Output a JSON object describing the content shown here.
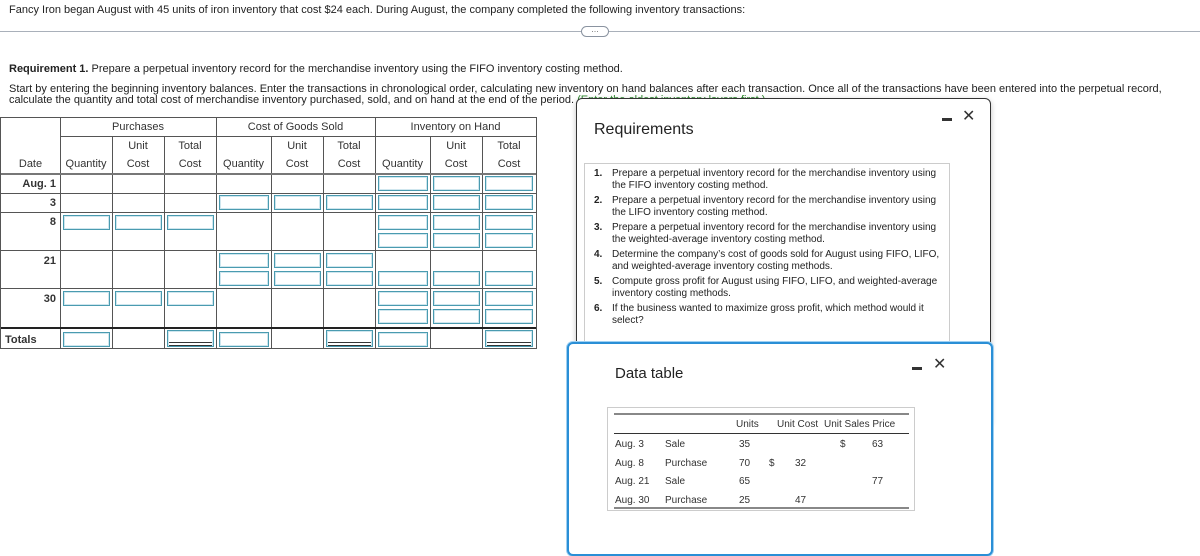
{
  "intro_text": "Fancy Iron began August with 45 units of iron inventory that cost $24 each. During August, the company completed the following inventory transactions:",
  "more_button_label": "…",
  "requirement_heading": {
    "bold": "Requirement 1.",
    "text": " Prepare a perpetual inventory record for the merchandise inventory using the FIFO inventory costing method."
  },
  "instructions": {
    "text": "Start by entering the beginning inventory balances. Enter the transactions in chronological order, calculating new inventory on hand balances after each transaction. Once all of the transactions have been entered into the perpetual record, calculate the quantity and total cost of merchandise inventory purchased, sold, and on hand at the end of the period. ",
    "hint": "(Enter the oldest inventory layers first.)"
  },
  "inventory_table": {
    "groups": [
      "Purchases",
      "Cost of Goods Sold",
      "Inventory on Hand"
    ],
    "date_header": "Date",
    "sub_headers": {
      "quantity": "Quantity",
      "unit_top": "Unit",
      "unit_bottom": "Cost",
      "total_top": "Total",
      "total_bottom": "Cost"
    },
    "rows": [
      {
        "date": "Aug. 1"
      },
      {
        "date": "3"
      },
      {
        "date": "8"
      },
      {
        "date": "21"
      },
      {
        "date": "30"
      }
    ],
    "totals_label": "Totals"
  },
  "requirements_panel": {
    "title": "Requirements",
    "items": [
      {
        "num": "1.",
        "text": "Prepare a perpetual inventory record for the merchandise inventory using the FIFO inventory costing method."
      },
      {
        "num": "2.",
        "text": "Prepare a perpetual inventory record for the merchandise inventory using the LIFO inventory costing method."
      },
      {
        "num": "3.",
        "text": "Prepare a perpetual inventory record for the merchandise inventory using the weighted-average inventory costing method."
      },
      {
        "num": "4.",
        "text": "Determine the company’s cost of goods sold for August using FIFO, LIFO, and weighted-average inventory costing methods."
      },
      {
        "num": "5.",
        "text": "Compute gross profit for August using FIFO, LIFO, and weighted-average inventory costing methods."
      },
      {
        "num": "6.",
        "text": "If the business wanted to maximize gross profit, which method would it select?"
      }
    ]
  },
  "data_panel": {
    "title": "Data table",
    "headers": {
      "units": "Units",
      "unit_cost": "Unit Cost",
      "unit_sales_price": "Unit Sales Price"
    },
    "rows": [
      {
        "date": "Aug. 3",
        "type": "Sale",
        "units": "35",
        "cost_sign": "",
        "unit_cost": "",
        "price_sign": "$",
        "unit_sales_price": "63"
      },
      {
        "date": "Aug. 8",
        "type": "Purchase",
        "units": "70",
        "cost_sign": "$",
        "unit_cost": "32",
        "price_sign": "",
        "unit_sales_price": ""
      },
      {
        "date": "Aug. 21",
        "type": "Sale",
        "units": "65",
        "cost_sign": "",
        "unit_cost": "",
        "price_sign": "",
        "unit_sales_price": "77"
      },
      {
        "date": "Aug. 30",
        "type": "Purchase",
        "units": "25",
        "cost_sign": "",
        "unit_cost": "47",
        "price_sign": "",
        "unit_sales_price": ""
      }
    ]
  },
  "icons": {
    "minimize": "minimize-icon",
    "close": "✕"
  },
  "colors": {
    "input_border": "#4a9bb0",
    "panel_accent": "#2a8fd6",
    "hint_green": "#2f8a2f"
  }
}
